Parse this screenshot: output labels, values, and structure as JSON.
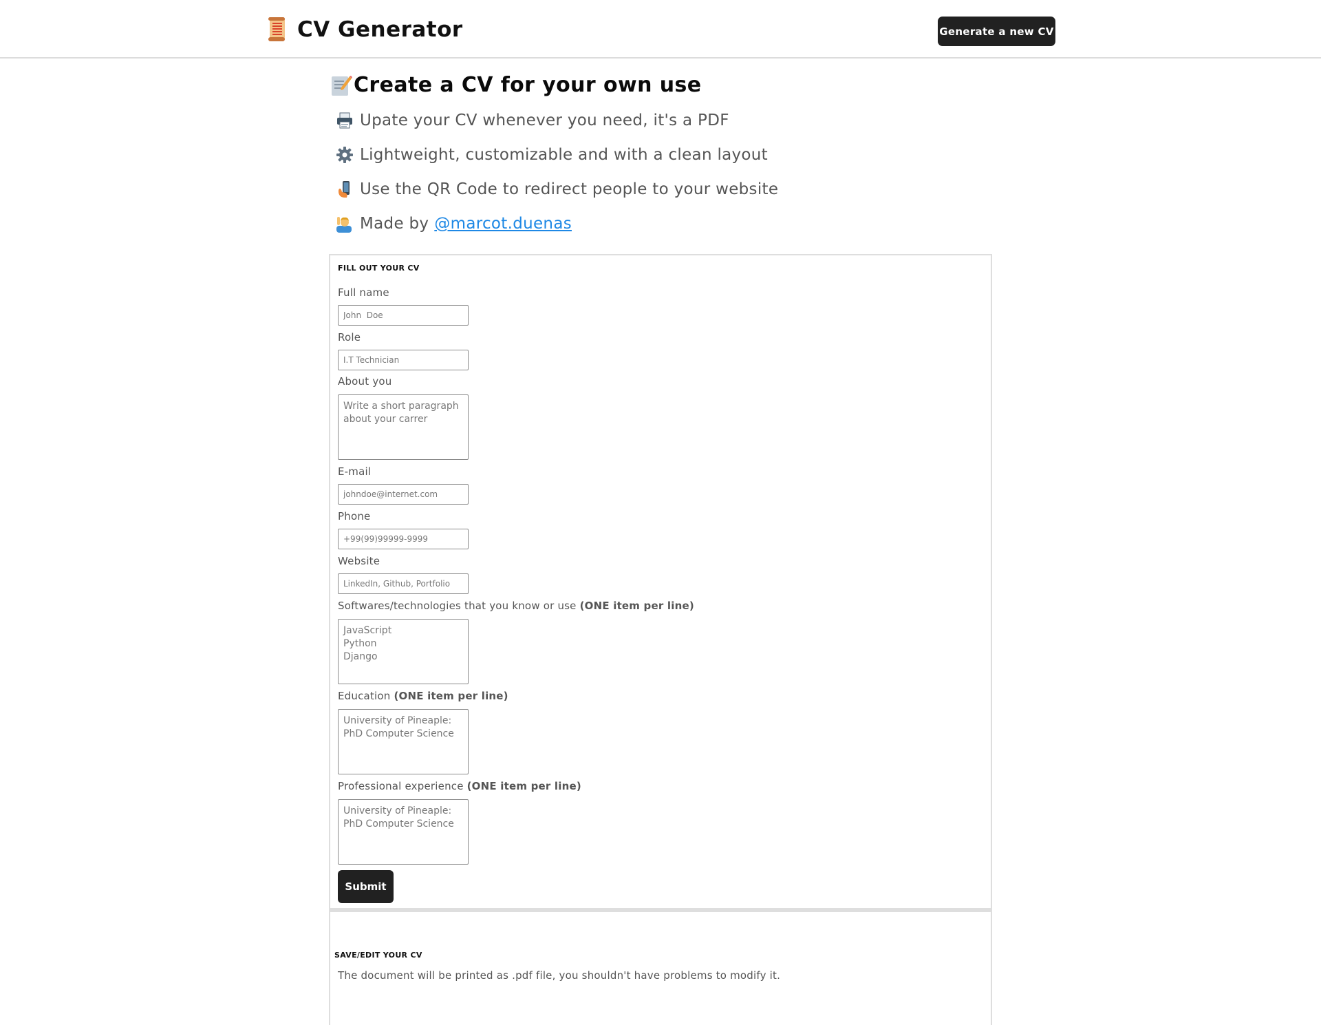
{
  "header": {
    "brand_icon": "scroll-icon",
    "title": "CV Generator",
    "generate_button": "Generate a new CV"
  },
  "intro": {
    "title_icon": "memo-icon",
    "title": "Create a CV for your own use",
    "features": [
      {
        "icon": "printer-icon",
        "text": "Upate your CV whenever you need, it's a PDF"
      },
      {
        "icon": "gear-icon",
        "text": "Lightweight, customizable and with a clean layout"
      },
      {
        "icon": "mobile-phone-icon",
        "text": "Use the QR Code to redirect people to your website"
      },
      {
        "icon": "person-raising-hand-icon",
        "text": "Made by",
        "link": "@marcot.duenas"
      }
    ]
  },
  "form": {
    "heading": "FILL OUT YOUR CV",
    "full_name": {
      "label": "Full name",
      "placeholder": "John  Doe",
      "value": ""
    },
    "role": {
      "label": "Role",
      "placeholder": "I.T Technician",
      "value": ""
    },
    "about": {
      "label": "About you",
      "placeholder": "Write a short paragraph about your carrer",
      "value": ""
    },
    "email": {
      "label": "E-mail",
      "placeholder": "johndoe@internet.com",
      "value": ""
    },
    "phone": {
      "label": "Phone",
      "placeholder": "+99(99)99999-9999",
      "value": ""
    },
    "website": {
      "label": "Website",
      "placeholder": "LinkedIn, Github, Portfolio",
      "value": ""
    },
    "skills": {
      "label": "Softwares/technologies that you know or use",
      "hint": "(ONE item per line)",
      "placeholder": "JavaScript\nPython\nDjango",
      "value": ""
    },
    "education": {
      "label": "Education",
      "hint": "(ONE item per line)",
      "placeholder": "University of Pineaple: PhD Computer Science",
      "value": ""
    },
    "experience": {
      "label": "Professional experience",
      "hint": "(ONE item per line)",
      "placeholder": "University of Pineaple: PhD Computer Science",
      "value": ""
    },
    "submit": "Submit"
  },
  "save": {
    "heading": "SAVE/EDIT YOUR CV",
    "text": "The document will be printed as .pdf file, you shouldn't have problems to modify it."
  },
  "colors": {
    "button_bg": "#212121",
    "link": "#1e88e5",
    "muted_text": "#555555",
    "border": "#dedede"
  }
}
